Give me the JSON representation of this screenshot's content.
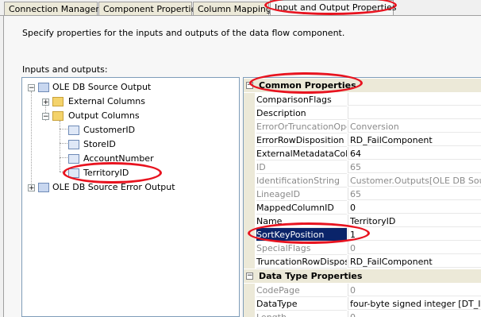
{
  "tabs": [
    {
      "label": "Connection Managers"
    },
    {
      "label": "Component Properties"
    },
    {
      "label": "Column Mappings"
    },
    {
      "label": "Input and Output Properties",
      "selected": true
    }
  ],
  "description": "Specify properties for the inputs and outputs of the data flow component.",
  "io_label": "Inputs and outputs:",
  "tree": {
    "output": "OLE DB Source Output",
    "external_columns": "External Columns",
    "output_columns": "Output Columns",
    "columns": [
      "CustomerID",
      "StoreID",
      "AccountNumber",
      "TerritoryID"
    ],
    "error_output": "OLE DB Source Error Output",
    "selected": "TerritoryID"
  },
  "grid": {
    "common_title": "Common Properties",
    "common": [
      {
        "name": "ComparisonFlags",
        "value": "",
        "readonly": false
      },
      {
        "name": "Description",
        "value": "",
        "readonly": false
      },
      {
        "name": "ErrorOrTruncationOper",
        "value": "Conversion",
        "readonly": true
      },
      {
        "name": "ErrorRowDisposition",
        "value": "RD_FailComponent",
        "readonly": false
      },
      {
        "name": "ExternalMetadataColur",
        "value": "64",
        "readonly": false
      },
      {
        "name": "ID",
        "value": "65",
        "readonly": true
      },
      {
        "name": "IdentificationString",
        "value": "Customer.Outputs[OLE DB Source",
        "readonly": true
      },
      {
        "name": "LineageID",
        "value": "65",
        "readonly": true
      },
      {
        "name": "MappedColumnID",
        "value": "0",
        "readonly": false
      },
      {
        "name": "Name",
        "value": "TerritoryID",
        "readonly": false
      },
      {
        "name": "SortKeyPosition",
        "value": "1",
        "readonly": false,
        "selected": true
      },
      {
        "name": "SpecialFlags",
        "value": "0",
        "readonly": true
      },
      {
        "name": "TruncationRowDispositi",
        "value": "RD_FailComponent",
        "readonly": false
      }
    ],
    "datatype_title": "Data Type Properties",
    "datatype": [
      {
        "name": "CodePage",
        "value": "0",
        "readonly": true
      },
      {
        "name": "DataType",
        "value": "four-byte signed integer [DT_I",
        "readonly": false
      },
      {
        "name": "Length",
        "value": "0",
        "readonly": true
      }
    ]
  },
  "colors": {
    "highlight": "#e8131f",
    "selection": "#0a246a"
  }
}
